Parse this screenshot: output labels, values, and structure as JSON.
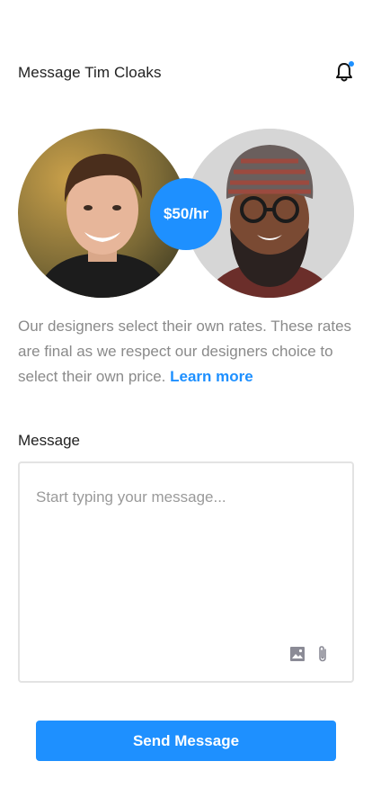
{
  "header": {
    "title": "Message Tim Cloaks",
    "notification_dot_color": "#1e90ff"
  },
  "rate": {
    "label": "$50/hr",
    "badge_color": "#1e90ff"
  },
  "info": {
    "text": "Our designers select their own rates. These rates are final as we respect our designers choice to select their own price.",
    "link_label": "Learn more",
    "link_color": "#1e90ff"
  },
  "message": {
    "label": "Message",
    "placeholder": "Start typing your message..."
  },
  "send_button": {
    "label": "Send Message",
    "color": "#1e90ff"
  },
  "icons": {
    "notification": "bell-icon",
    "image": "image-icon",
    "attach": "paperclip-icon"
  }
}
